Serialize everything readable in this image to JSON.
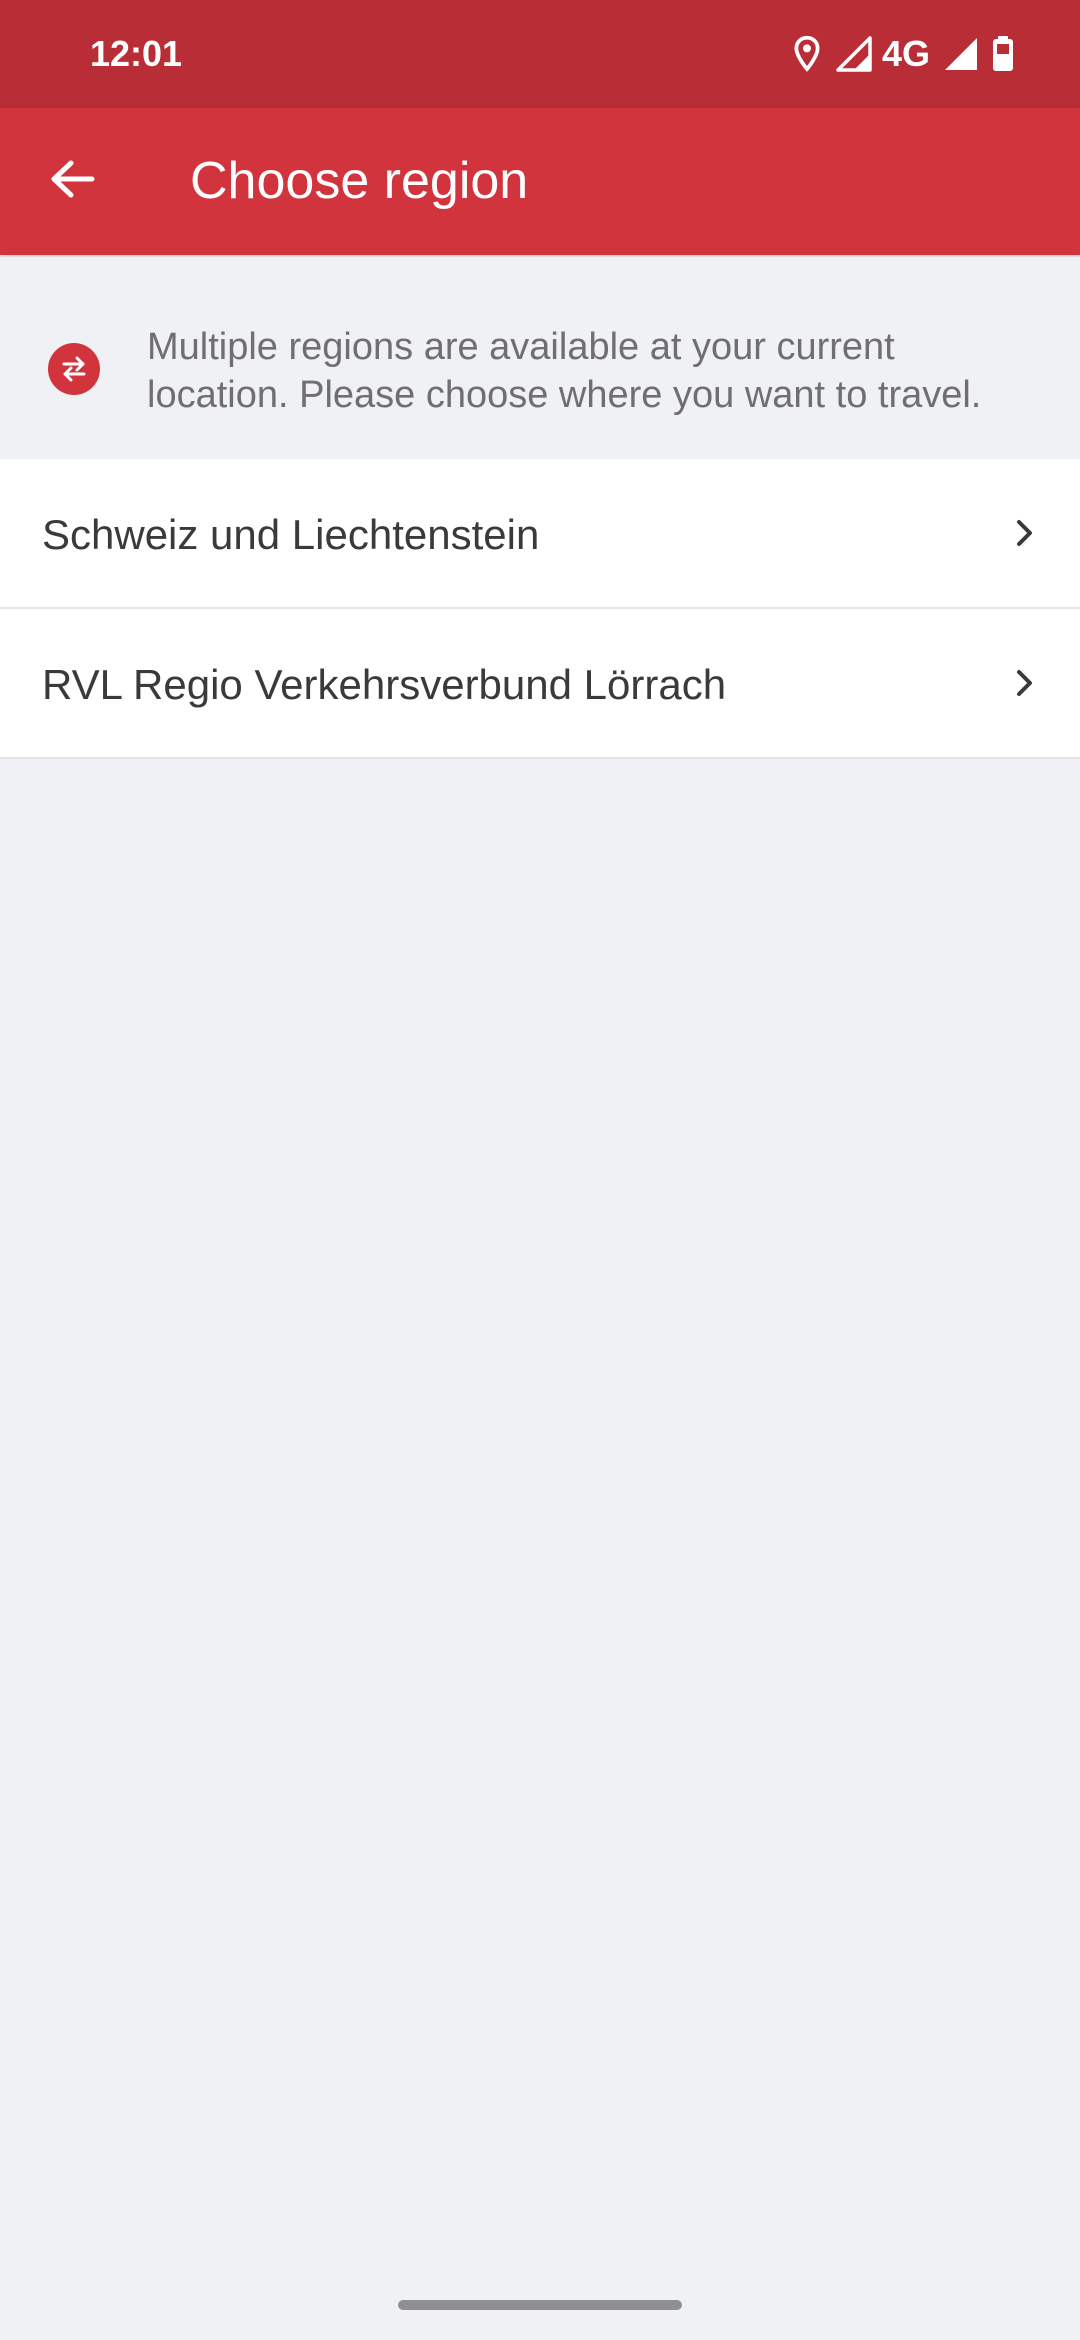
{
  "status_bar": {
    "time": "12:01",
    "network": "4G",
    "icons": [
      "location-icon",
      "signal-icon",
      "signal-icon",
      "battery-icon"
    ]
  },
  "app_bar": {
    "title": "Choose region",
    "back_icon": "arrow-left-icon"
  },
  "info_banner": {
    "icon": "swap-arrows-icon",
    "message": "Multiple regions are available at your current location. Please choose where you want to travel."
  },
  "regions": [
    {
      "label": "Schweiz und Liechtenstein",
      "icon": "chevron-right-icon"
    },
    {
      "label": "RVL Regio Verkehrsverbund Lörrach",
      "icon": "chevron-right-icon"
    }
  ],
  "colors": {
    "status_bar": "#B92D36",
    "app_bar": "#D1343D",
    "background": "#F0F1F5",
    "list_background": "#FFFFFF",
    "text_primary": "#3A3A3C",
    "text_secondary": "#6E6E73"
  }
}
